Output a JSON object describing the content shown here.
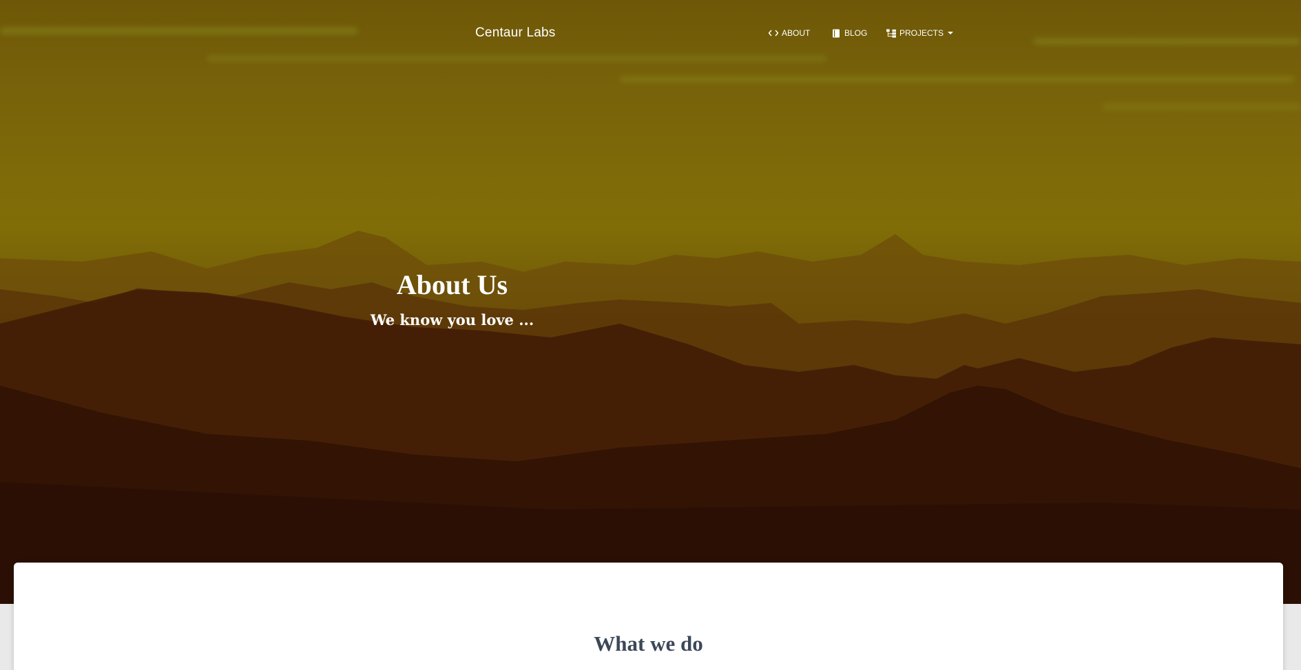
{
  "nav": {
    "brand": "Centaur Labs",
    "items": [
      {
        "label": "ABOUT",
        "icon": "code-icon"
      },
      {
        "label": "BLOG",
        "icon": "book-icon"
      },
      {
        "label": "PROJECTS",
        "icon": "sitemap-icon",
        "has_dropdown": true
      }
    ]
  },
  "hero": {
    "title": "About Us",
    "subtitle": "We know you love ..."
  },
  "main": {
    "section_title": "What we do"
  },
  "colors": {
    "hero_top": "#7a640a",
    "hero_bottom": "#2a1005",
    "card_background": "#ffffff",
    "section_title": "#3c4858",
    "nav_text": "#ffffff"
  }
}
